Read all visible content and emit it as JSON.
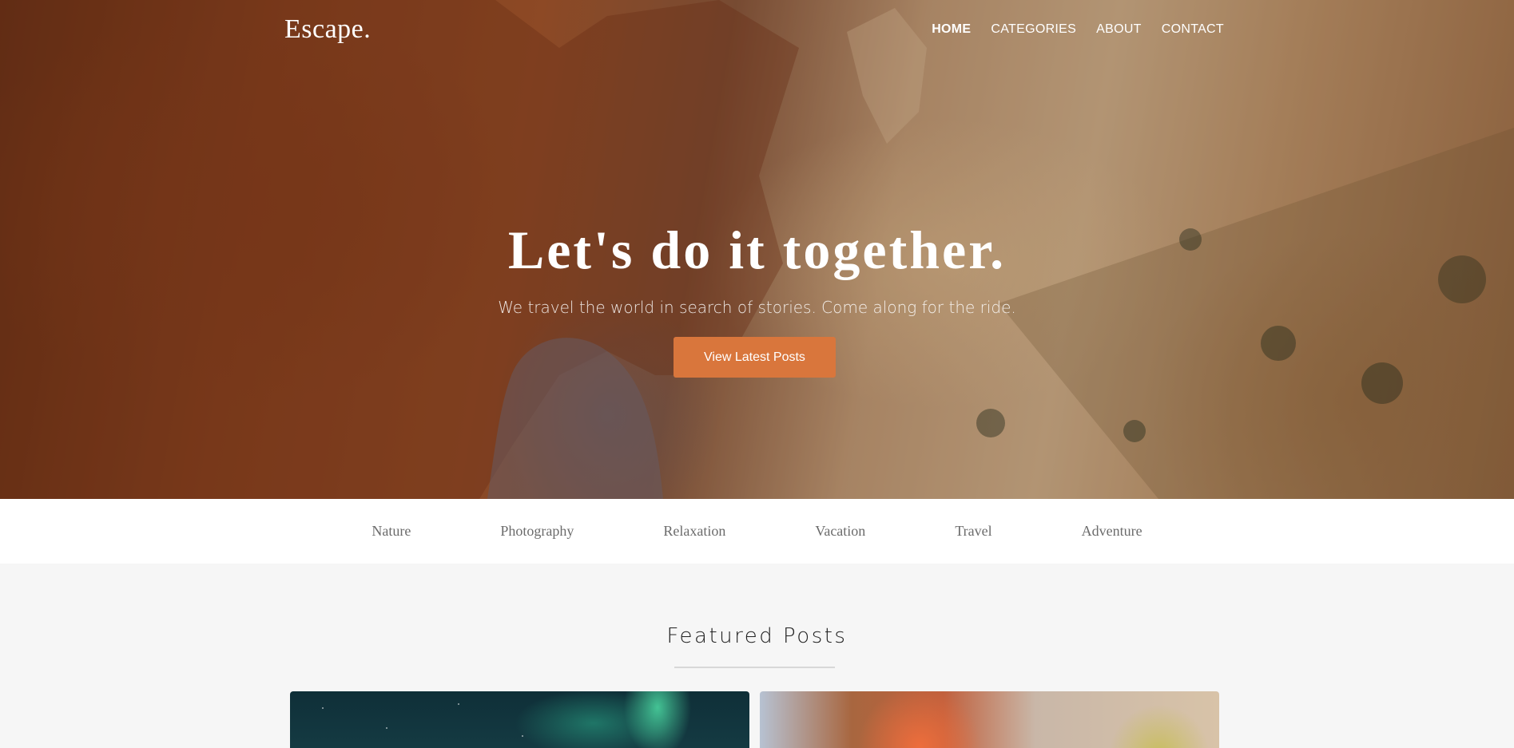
{
  "brand": {
    "logo_text": "Escape."
  },
  "nav": {
    "items": [
      {
        "label": "HOME",
        "active": true
      },
      {
        "label": "CATEGORIES",
        "active": false
      },
      {
        "label": "ABOUT",
        "active": false
      },
      {
        "label": "CONTACT",
        "active": false
      }
    ]
  },
  "hero": {
    "title": "Let's do it together.",
    "subtitle": "We travel the world in search of stories. Come along for the ride.",
    "cta_label": "View Latest Posts"
  },
  "categories": {
    "items": [
      "Nature",
      "Photography",
      "Relaxation",
      "Vacation",
      "Travel",
      "Adventure"
    ]
  },
  "featured": {
    "title": "Featured Posts"
  },
  "colors": {
    "accent": "#d9763c",
    "category_text": "#6b6b6b",
    "page_background": "#f6f6f6"
  }
}
